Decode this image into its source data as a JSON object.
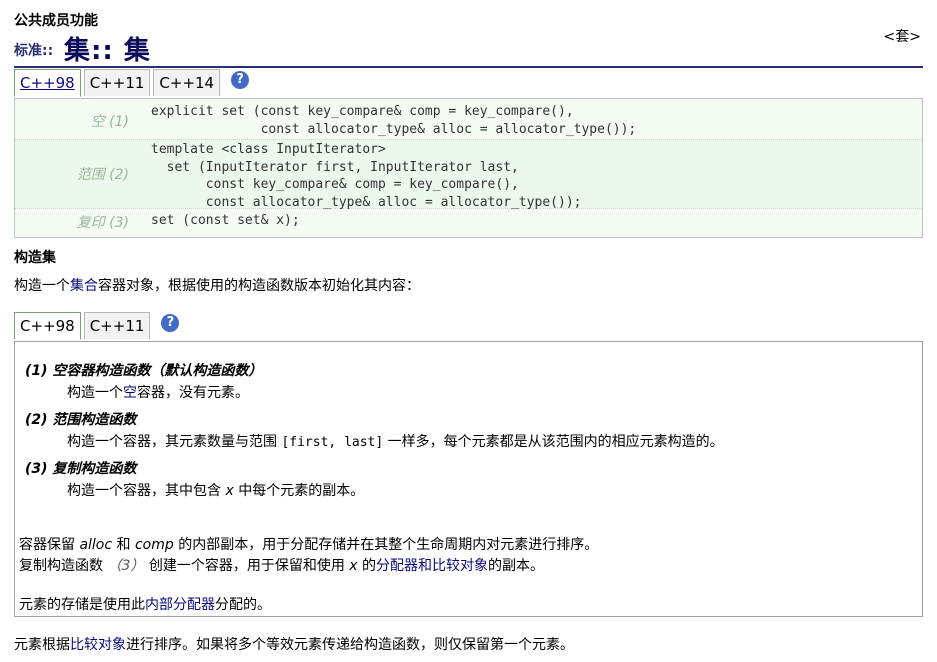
{
  "header": {
    "section": "公共成员功能",
    "prefix": "标准::",
    "title": "集::  集",
    "set_link": "<套>"
  },
  "tabs_top": [
    "C++98",
    "C++11",
    "C++14"
  ],
  "help_icon": "?",
  "prototypes": [
    {
      "name": "空  (1)",
      "code": "explicit set (const key_compare& comp = key_compare(),\n              const allocator_type& alloc = allocator_type());"
    },
    {
      "name": "范围  (2)",
      "code": "template <class InputIterator>\n  set (InputIterator first, InputIterator last,\n       const key_compare& comp = key_compare(),\n       const allocator_type& alloc = allocator_type());"
    },
    {
      "name": "复印  (3)",
      "code": "set (const set& x);"
    }
  ],
  "construct": {
    "heading": "构造集",
    "desc_pre": "构造一个",
    "desc_link": "集合",
    "desc_post": "容器对象，根据使用的构造函数版本初始化其内容："
  },
  "tabs_mid": [
    "C++98",
    "C++11"
  ],
  "items": [
    {
      "head": "(1) 空容器构造函数（默认构造函数）",
      "body_pre": "构造一个",
      "body_link": "空",
      "body_post": "容器，没有元素。"
    },
    {
      "head": "(2) 范围构造函数",
      "body_pre": "构造一个容器，其元素数量与范围 ",
      "body_code": "[first, last]",
      "body_post": " 一样多，每个元素都是从该范围内的相应元素构造的。"
    },
    {
      "head": "(3) 复制构造函数",
      "body_pre": "构造一个容器，其中包含 ",
      "body_var": "x",
      "body_post": " 中每个元素的副本。"
    }
  ],
  "notes": {
    "p1_a": "容器保留 ",
    "p1_alloc": "alloc",
    "p1_b": " 和 ",
    "p1_comp": "comp",
    "p1_c": " 的内部副本，用于分配存储并在其整个生命周期内对元素进行排序。",
    "p2_a": "复制构造函数 ",
    "p2_num": "（3）",
    "p2_b": " 创建一个容器，用于保留和使用 ",
    "p2_x": "x",
    "p2_c": " 的",
    "p2_link": "分配器和比较对象",
    "p2_d": "的副本。",
    "p3_a": "元素的存储是使用此",
    "p3_link": "内部分配器",
    "p3_b": "分配的。"
  },
  "bottom": {
    "pre": "元素根据",
    "link": "比较对象",
    "post": "进行排序。如果将多个等效元素传递给构造函数，则仅保留第一个元素。"
  }
}
